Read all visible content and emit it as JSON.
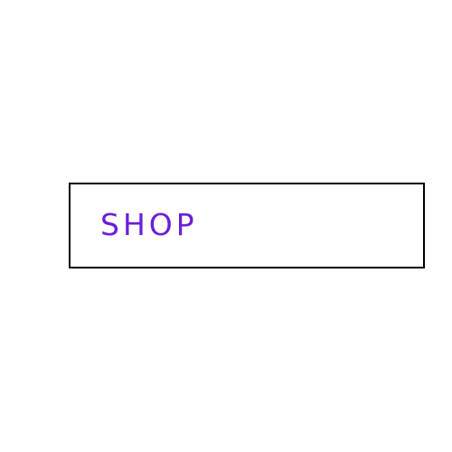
{
  "shop_button": {
    "label": "SHOP",
    "label_color": "#6a1fd9",
    "border_color": "#000000"
  },
  "background_color": "#ffffff"
}
